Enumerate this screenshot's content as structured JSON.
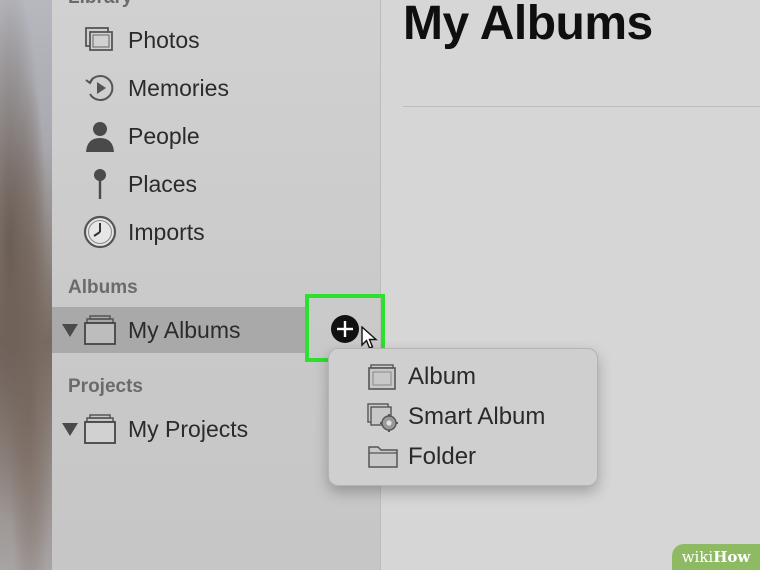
{
  "sidebar": {
    "library_label": "Library",
    "library_items": [
      {
        "label": "Photos",
        "icon": "photos-icon"
      },
      {
        "label": "Memories",
        "icon": "memories-icon"
      },
      {
        "label": "People",
        "icon": "people-icon"
      },
      {
        "label": "Places",
        "icon": "places-icon"
      },
      {
        "label": "Imports",
        "icon": "imports-icon"
      }
    ],
    "albums_label": "Albums",
    "albums_item": {
      "label": "My Albums",
      "icon": "albums-stack-icon"
    },
    "projects_label": "Projects",
    "projects_item": {
      "label": "My Projects",
      "icon": "projects-stack-icon"
    }
  },
  "main": {
    "title": "My Albums"
  },
  "popup_menu": {
    "items": [
      {
        "label": "Album",
        "icon": "album-icon"
      },
      {
        "label": "Smart Album",
        "icon": "smart-album-icon"
      },
      {
        "label": "Folder",
        "icon": "folder-icon"
      }
    ]
  },
  "watermark": {
    "prefix": "wiki",
    "suffix": "How"
  },
  "colors": {
    "highlight": "#2ee02e",
    "watermark_bg": "#8fba64",
    "selection_bg": "#a9a9a9"
  }
}
